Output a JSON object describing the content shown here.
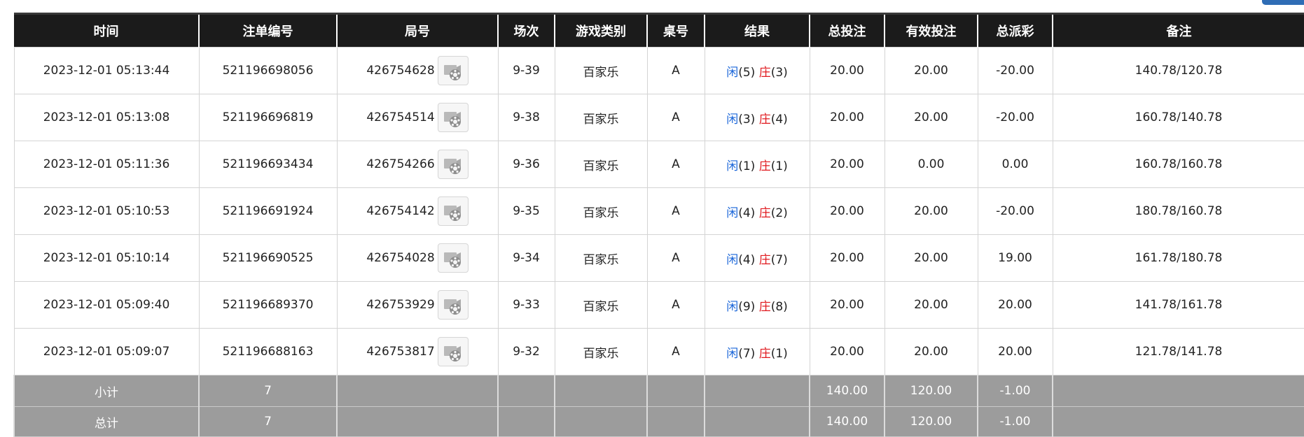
{
  "headers": [
    "时间",
    "注单编号",
    "局号",
    "场次",
    "游戏类别",
    "桌号",
    "结果",
    "总投注",
    "有效投注",
    "总派彩",
    "备注"
  ],
  "rows": [
    {
      "time": "2023-12-01 05:13:44",
      "bet_id": "521196698056",
      "round": "426754628",
      "shoe": "9-39",
      "game": "百家乐",
      "table": "A",
      "player_label": "闲",
      "player": "(5)",
      "banker_label": "庄",
      "banker": "(3)",
      "total_bet": "20.00",
      "valid_bet": "20.00",
      "payout": "-20.00",
      "payout_color": "red",
      "note": "140.78/120.78"
    },
    {
      "time": "2023-12-01 05:13:08",
      "bet_id": "521196696819",
      "round": "426754514",
      "shoe": "9-38",
      "game": "百家乐",
      "table": "A",
      "player_label": "闲",
      "player": "(3)",
      "banker_label": "庄",
      "banker": "(4)",
      "total_bet": "20.00",
      "valid_bet": "20.00",
      "payout": "-20.00",
      "payout_color": "red",
      "note": "160.78/140.78"
    },
    {
      "time": "2023-12-01 05:11:36",
      "bet_id": "521196693434",
      "round": "426754266",
      "shoe": "9-36",
      "game": "百家乐",
      "table": "A",
      "player_label": "闲",
      "player": "(1)",
      "banker_label": "庄",
      "banker": "(1)",
      "total_bet": "20.00",
      "valid_bet": "0.00",
      "payout": "0.00",
      "payout_color": "black",
      "note": "160.78/160.78"
    },
    {
      "time": "2023-12-01 05:10:53",
      "bet_id": "521196691924",
      "round": "426754142",
      "shoe": "9-35",
      "game": "百家乐",
      "table": "A",
      "player_label": "闲",
      "player": "(4)",
      "banker_label": "庄",
      "banker": "(2)",
      "total_bet": "20.00",
      "valid_bet": "20.00",
      "payout": "-20.00",
      "payout_color": "red",
      "note": "180.78/160.78"
    },
    {
      "time": "2023-12-01 05:10:14",
      "bet_id": "521196690525",
      "round": "426754028",
      "shoe": "9-34",
      "game": "百家乐",
      "table": "A",
      "player_label": "闲",
      "player": "(4)",
      "banker_label": "庄",
      "banker": "(7)",
      "total_bet": "20.00",
      "valid_bet": "20.00",
      "payout": "19.00",
      "payout_color": "black",
      "note": "161.78/180.78"
    },
    {
      "time": "2023-12-01 05:09:40",
      "bet_id": "521196689370",
      "round": "426753929",
      "shoe": "9-33",
      "game": "百家乐",
      "table": "A",
      "player_label": "闲",
      "player": "(9)",
      "banker_label": "庄",
      "banker": "(8)",
      "total_bet": "20.00",
      "valid_bet": "20.00",
      "payout": "20.00",
      "payout_color": "black",
      "note": "141.78/161.78"
    },
    {
      "time": "2023-12-01 05:09:07",
      "bet_id": "521196688163",
      "round": "426753817",
      "shoe": "9-32",
      "game": "百家乐",
      "table": "A",
      "player_label": "闲",
      "player": "(7)",
      "banker_label": "庄",
      "banker": "(1)",
      "total_bet": "20.00",
      "valid_bet": "20.00",
      "payout": "20.00",
      "payout_color": "black",
      "note": "121.78/141.78"
    }
  ],
  "subtotal": {
    "label": "小计",
    "count": "7",
    "total_bet": "140.00",
    "valid_bet": "120.00",
    "payout": "-1.00"
  },
  "grandtotal": {
    "label": "总计",
    "count": "7",
    "total_bet": "140.00",
    "valid_bet": "120.00",
    "payout": "-1.00"
  },
  "icons": {
    "replay": "video-replay-icon"
  },
  "colors": {
    "header_bg": "#1b1b1b",
    "summary_bg": "#9c9c9c",
    "bet_blue": "#1a66d9",
    "loss_red": "#e0191e",
    "accent_button": "#2f6db5"
  }
}
